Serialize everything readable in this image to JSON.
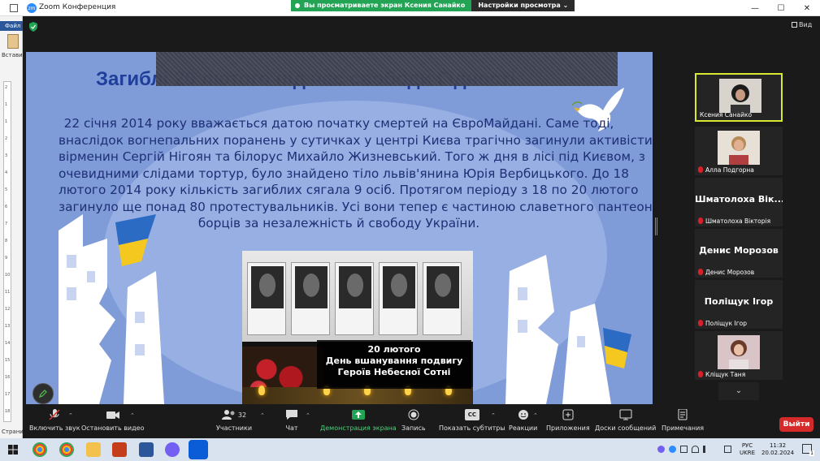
{
  "window": {
    "title": "Zoom Конференция",
    "share_banner": "Вы просматриваете экран Ксения Санайко",
    "view_options": "Настройки просмотра",
    "view_label": "Вид"
  },
  "word_strip": {
    "tab_file": "Файл",
    "paste": "Встави",
    "pages": "Страни",
    "ruler_ticks": [
      "2",
      "1",
      "1",
      "2",
      "3",
      "4",
      "5",
      "6",
      "7",
      "8",
      "9",
      "10",
      "11",
      "12",
      "13",
      "14",
      "15",
      "16",
      "17",
      "18"
    ]
  },
  "slide": {
    "title": "Загиблі 20 лютого під час свободи Гідності",
    "paragraph_lines": [
      "22 січня 2014 року вважається датою початку смертей на ЄвроМайдані. Саме тоді,",
      "внаслідок вогнепальних поранень у сутичках у центрі Києва трагічно загинули активісти —",
      "вірменин Сергій Нігоян та білорус Михайло Жизневський. Того ж дня в лісі під Києвом, з",
      "очевидними слідами тортур, було знайдено тіло львів'янина Юрія Вербицького. До 18",
      "лютого 2014 року кількість загиблих сягала 9 осіб. Протягом періоду з 18 по 20 лютого",
      "загинуло ще понад 80 протестувальників. Усі вони тепер є частиною славетного пантеону",
      "борців за незалежність й свободу України."
    ],
    "photo_caption": [
      "20 лютого",
      "День вшанування подвигу",
      "Героїв Небесної Сотні"
    ]
  },
  "participants": [
    {
      "name": "Ксения Санайко",
      "video": true,
      "muted": false,
      "active": true
    },
    {
      "name": "Алла Подгорна",
      "video": true,
      "muted": true
    },
    {
      "name": "Шматолоха Вікторія",
      "display": "Шматолоха  Вік...",
      "video": false,
      "muted": true
    },
    {
      "name": "Денис Морозов",
      "display": "Денис Морозов",
      "video": false,
      "muted": true
    },
    {
      "name": "Поліщук Ігор",
      "display": "Поліщук Ігор",
      "video": false,
      "muted": true
    },
    {
      "name": "Кліщук Таня",
      "video": true,
      "muted": true
    }
  ],
  "toolbar": {
    "unmute": "Включить звук",
    "video": "Остановить видео",
    "participants": "Участники",
    "participants_count": "32",
    "chat": "Чат",
    "share": "Демонстрация экрана",
    "record": "Запись",
    "captions": "Показать субтитры",
    "cc": "CC",
    "reactions": "Реакции",
    "apps": "Приложения",
    "whiteboards": "Доски сообщений",
    "notes": "Примечания",
    "leave": "Выйти"
  },
  "taskbar": {
    "lang_top": "РУС",
    "lang_bottom": "UKRE",
    "time": "11:32",
    "date": "20.02.2024",
    "notif_count": "1"
  },
  "colors": {
    "zoom_blue": "#2d8cff",
    "share_green": "#23a455",
    "leave_red": "#d42a2a",
    "active_speaker": "#d9e830"
  }
}
